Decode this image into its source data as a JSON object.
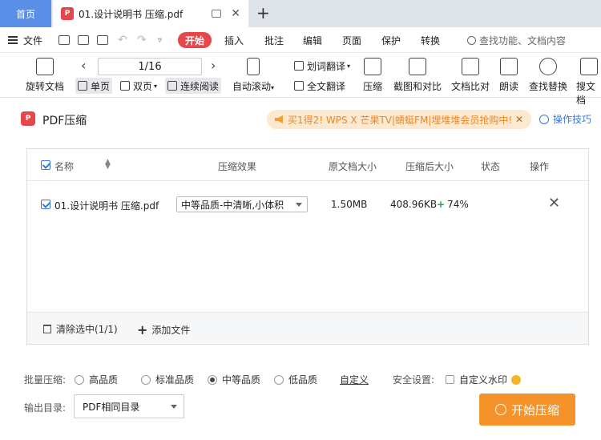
{
  "tabs": {
    "home": "首页",
    "document": "01.设计说明书 压缩.pdf",
    "pdf_badge": "P"
  },
  "menu": {
    "file": "文件",
    "start": "开始",
    "items": [
      "插入",
      "批注",
      "编辑",
      "页面",
      "保护",
      "转换"
    ],
    "search": "查找功能、文档内容"
  },
  "ribbon": {
    "rotate": "旋转文档",
    "page_value": "1/16",
    "single": "单页",
    "double": "双页",
    "continuous": "连续阅读",
    "auto_scroll": "自动滚动",
    "word_translate": "划词翻译",
    "full_translate": "全文翻译",
    "compress": "压缩",
    "screenshot": "截图和对比",
    "compare": "文档比对",
    "read": "朗读",
    "find_replace": "查找替换",
    "search_file": "搜文档"
  },
  "dialog": {
    "logo": "P",
    "title": "PDF压缩",
    "promo": "买1得2! WPS X 芒果TV|蜻蜓FM|埋堆堆会员抢购中!",
    "tips": "操作技巧"
  },
  "table": {
    "headers": {
      "name": "名称",
      "effect": "压缩效果",
      "orig": "原文档大小",
      "after": "压缩后大小",
      "status": "状态",
      "action": "操作"
    },
    "rows": [
      {
        "name": "01.设计说明书 压缩.pdf",
        "effect": "中等品质-中清晰,小体积",
        "orig": "1.50MB",
        "after": "408.96KB",
        "ratio": "74%"
      }
    ],
    "clear": "清除选中(1/1)",
    "add": "添加文件"
  },
  "options": {
    "batch_label": "批量压缩:",
    "qualities": [
      "高品质",
      "标准品质",
      "中等品质",
      "低品质"
    ],
    "selected_quality": "中等品质",
    "custom": "自定义",
    "security_label": "安全设置:",
    "watermark": "自定义水印",
    "output_label": "输出目录:",
    "output_value": "PDF相同目录",
    "start_button": "开始压缩"
  },
  "colors": {
    "accent_red": "#e5474b",
    "accent_orange": "#f5932a",
    "link_blue": "#3a78d6"
  }
}
